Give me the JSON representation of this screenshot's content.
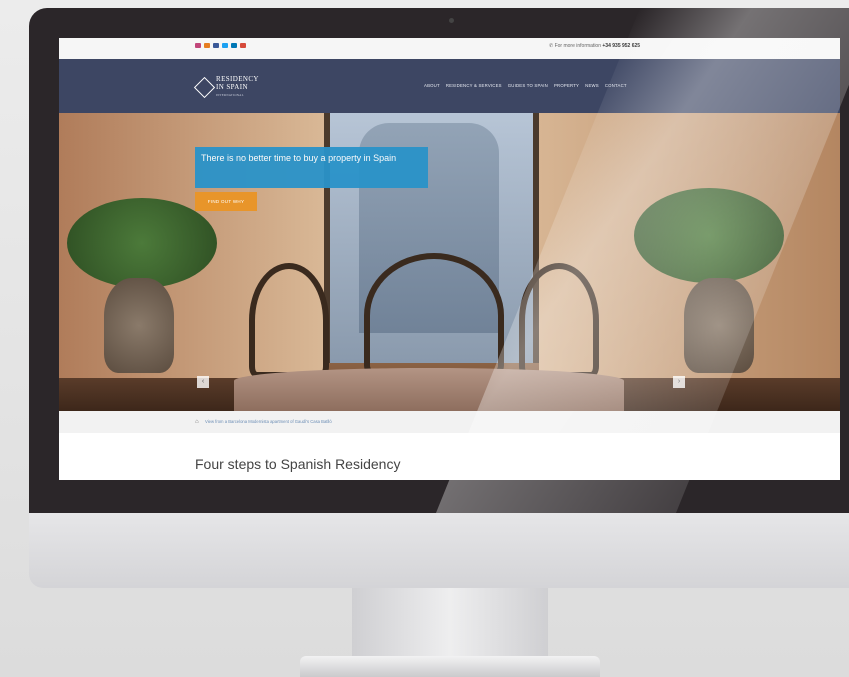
{
  "topbar": {
    "social_colors": [
      "#c1477a",
      "#e67e22",
      "#3b5998",
      "#1da1f2",
      "#0077b5",
      "#d64a3a"
    ],
    "contact_prefix": "For more information",
    "contact_phone": "+34 935 952 625"
  },
  "nav": {
    "logo_line1": "RESIDENCY",
    "logo_line2": "IN SPAIN",
    "logo_sub": "INTERNATIONAL",
    "menu": [
      "ABOUT",
      "RESIDENCY & SERVICES",
      "GUIDES TO SPAIN",
      "PROPERTY",
      "NEWS",
      "CONTACT"
    ]
  },
  "hero": {
    "headline": "There is no better time to buy a property in Spain",
    "cta_label": "FIND OUT WHY",
    "prev_arrow": "‹",
    "next_arrow": "›"
  },
  "breadcrumb": {
    "home_icon": "home-icon",
    "text": "View from a Barcelona Modernista apartment of Gaudí's Casa Batlló"
  },
  "content": {
    "heading": "Four steps to Spanish Residency"
  },
  "colors": {
    "nav_bg": "#3d4663",
    "banner_bg": "#2a93c9",
    "cta_bg": "#e8952a"
  }
}
